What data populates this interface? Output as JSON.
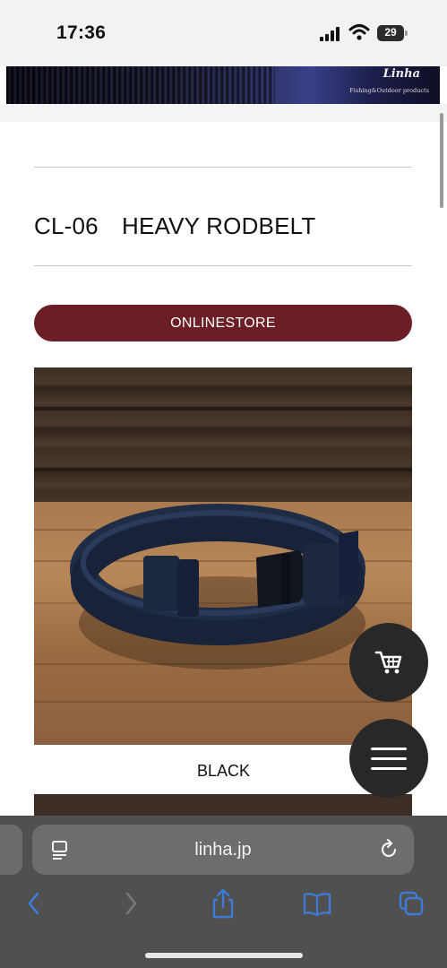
{
  "status_bar": {
    "time": "17:36",
    "battery": "29",
    "icons": [
      "signal-icon",
      "wifi-icon",
      "battery-icon"
    ]
  },
  "site": {
    "logo": "Linha",
    "tagline": "Fishing&Outdoor products"
  },
  "product": {
    "title": "CL-06　HEAVY RODBELT",
    "store_button": "ONLINESTORE",
    "variant_label": "BLACK"
  },
  "floating_buttons": {
    "cart": "cart-icon",
    "menu": "menu-icon"
  },
  "browser": {
    "url": "linha.jp",
    "icons": [
      "reader-mode-icon",
      "reload-icon",
      "back-icon",
      "forward-icon",
      "share-icon",
      "bookmarks-icon",
      "tabs-icon"
    ]
  },
  "colors": {
    "accent": "#6b1e26",
    "browser_toolbar": "#505050",
    "toolbar_icon": "#3e7bd6",
    "fab": "#282828"
  }
}
